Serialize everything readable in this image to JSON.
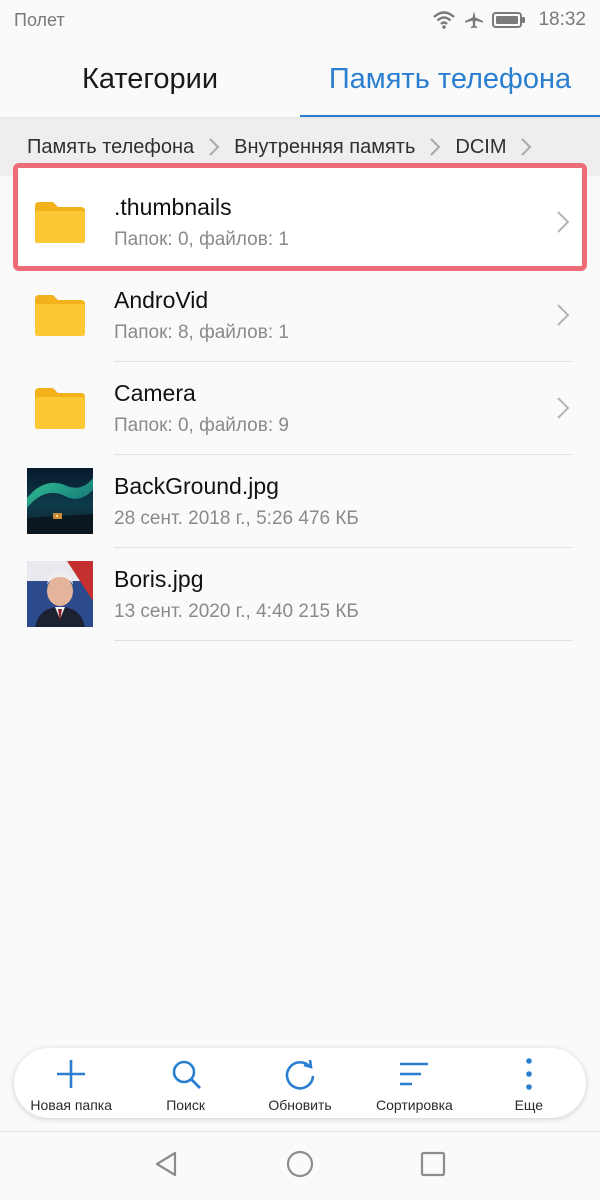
{
  "status_bar": {
    "carrier": "Полет",
    "time": "18:32",
    "icons": [
      "wifi-icon",
      "airplane-icon",
      "battery-icon"
    ]
  },
  "tabs": [
    {
      "label": "Категории",
      "active": false
    },
    {
      "label": "Память телефона",
      "active": true
    }
  ],
  "breadcrumb": [
    "Память телефона",
    "Внутренняя память",
    "DCIM"
  ],
  "files": [
    {
      "name": ".thumbnails",
      "meta": "Папок: 0, файлов: 1",
      "type": "folder",
      "highlighted": true
    },
    {
      "name": "AndroVid",
      "meta": "Папок: 8, файлов: 1",
      "type": "folder"
    },
    {
      "name": "Camera",
      "meta": "Папок: 0, файлов: 9",
      "type": "folder"
    },
    {
      "name": "BackGround.jpg",
      "meta": "28 сент. 2018 г., 5:26 476 КБ",
      "type": "image",
      "thumbnail": "aurora-landscape-image"
    },
    {
      "name": "Boris.jpg",
      "meta": "13 сент. 2020 г., 4:40 215 КБ",
      "type": "image",
      "thumbnail": "portrait-photo-image"
    }
  ],
  "toolbar": {
    "new_folder": "Новая папка",
    "search": "Поиск",
    "refresh": "Обновить",
    "sort": "Сортировка",
    "more": "Еще"
  },
  "colors": {
    "accent": "#2b7fd0",
    "folder": "#fbc02d",
    "highlight": "#ee6b78"
  }
}
